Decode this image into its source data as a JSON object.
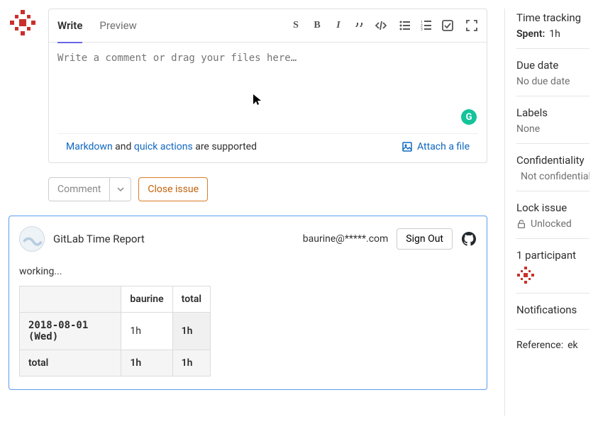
{
  "tabs": {
    "write": "Write",
    "preview": "Preview"
  },
  "toolbar": {
    "icons": [
      "strike",
      "bold",
      "italic",
      "quote",
      "code",
      "ul",
      "ol",
      "task",
      "fullscreen"
    ]
  },
  "comment": {
    "placeholder": "Write a comment or drag your files here…",
    "markdown_text": "Markdown",
    "and_text": " and ",
    "quick_actions_text": "quick actions",
    "supported_text": " are supported",
    "attach_label": "Attach a file",
    "comment_btn": "Comment",
    "close_btn": "Close issue"
  },
  "report": {
    "title": "GitLab Time Report",
    "email": "baurine@*****.com",
    "sign_out": "Sign Out",
    "status": "working...",
    "table": {
      "headers": [
        "",
        "baurine",
        "total"
      ],
      "rows": [
        {
          "date": "2018-08-01 (Wed)",
          "user": "1h",
          "total": "1h"
        }
      ],
      "total_label": "total",
      "total_user": "1h",
      "total_total": "1h"
    }
  },
  "sidebar": {
    "time_tracking": {
      "title": "Time tracking",
      "spent_label": "Spent:",
      "spent_value": "1h"
    },
    "due_date": {
      "title": "Due date",
      "value": "No due date"
    },
    "labels": {
      "title": "Labels",
      "value": "None"
    },
    "confidentiality": {
      "title": "Confidentiality",
      "value": "Not confidential"
    },
    "lock": {
      "title": "Lock issue",
      "value": "Unlocked"
    },
    "participants": {
      "title": "1 participant"
    },
    "notifications": {
      "title": "Notifications"
    },
    "reference": {
      "prefix": "Reference: ",
      "value": "ek"
    }
  }
}
